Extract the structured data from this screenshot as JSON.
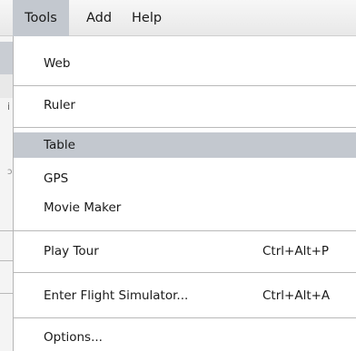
{
  "menubar": {
    "tools": "Tools",
    "add": "Add",
    "help": "Help"
  },
  "tools_menu": {
    "web": "Web",
    "ruler": "Ruler",
    "table": "Table",
    "gps": "GPS",
    "movie_maker": "Movie Maker",
    "play_tour": "Play Tour",
    "play_tour_shortcut": "Ctrl+Alt+P",
    "flight_simulator": "Enter Flight Simulator...",
    "flight_simulator_shortcut": "Ctrl+Alt+A",
    "options": "Options..."
  },
  "background": {
    "hint_1": "i",
    "hint_2": "ɔl"
  },
  "colors": {
    "highlight": "#c3c8cf",
    "separator": "#b9b9b9"
  }
}
